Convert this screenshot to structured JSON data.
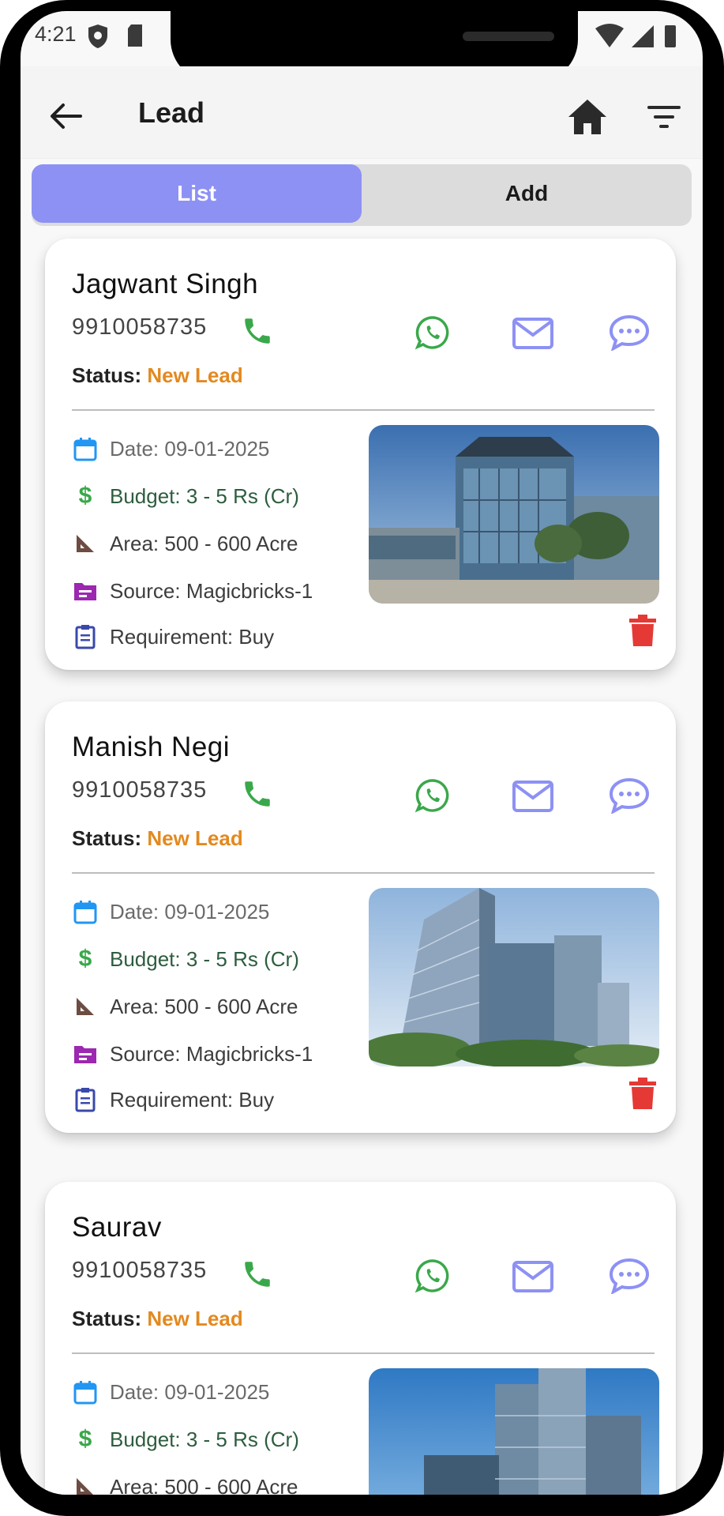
{
  "status_bar": {
    "time": "4:21"
  },
  "header": {
    "title": "Lead"
  },
  "tabs": [
    {
      "label": "List",
      "active": true
    },
    {
      "label": "Add",
      "active": false
    }
  ],
  "colors": {
    "accent": "#8d91f4",
    "status": "#e3891f",
    "call": "#3aa84a",
    "delete": "#e53935"
  },
  "leads": [
    {
      "name": "Jagwant Singh",
      "phone": "9910058735",
      "status_label": "Status:",
      "status": "New Lead",
      "date": "Date: 09-01-2025",
      "budget": "Budget: 3 - 5 Rs (Cr)",
      "area": "Area: 500 - 600 Acre",
      "source": "Source: Magicbricks-1",
      "requirement": "Requirement: Buy"
    },
    {
      "name": "Manish Negi",
      "phone": "9910058735",
      "status_label": "Status:",
      "status": "New Lead",
      "date": "Date: 09-01-2025",
      "budget": "Budget: 3 - 5 Rs (Cr)",
      "area": "Area: 500 - 600 Acre",
      "source": "Source: Magicbricks-1",
      "requirement": "Requirement: Buy"
    },
    {
      "name": "Saurav",
      "phone": "9910058735",
      "status_label": "Status:",
      "status": "New Lead",
      "date": "Date: 09-01-2025",
      "budget": "Budget: 3 - 5 Rs (Cr)",
      "area": "Area: 500 - 600 Acre"
    }
  ]
}
